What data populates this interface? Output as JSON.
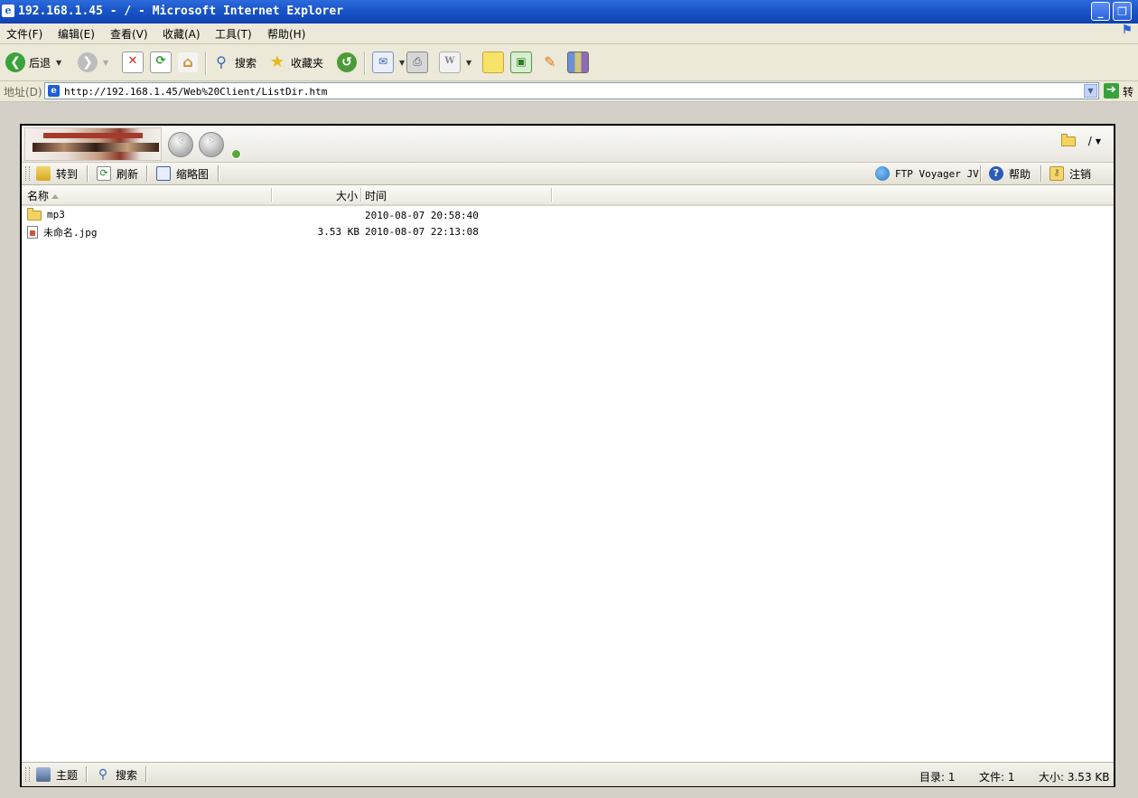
{
  "window": {
    "title": "192.168.1.45 - / - Microsoft Internet Explorer",
    "minimize_glyph": "_",
    "restore_glyph": "❐"
  },
  "menu": [
    "文件(F)",
    "编辑(E)",
    "查看(V)",
    "收藏(A)",
    "工具(T)",
    "帮助(H)"
  ],
  "toolbar": {
    "back_label": "后退",
    "search_label": "搜索",
    "favorites_label": "收藏夹"
  },
  "address": {
    "label": "地址(D)",
    "url": "http://192.168.1.45/Web%20Client/ListDir.htm",
    "go_label": "转"
  },
  "ftp": {
    "current_path": "/",
    "toolbar": {
      "goto_label": "转到",
      "refresh_label": "刷新",
      "thumbnail_label": "缩略图",
      "voyager_label": "FTP Voyager JV",
      "help_label": "帮助",
      "logout_label": "注销"
    },
    "columns": {
      "name": "名称",
      "size": "大小",
      "time": "时间"
    },
    "files": [
      {
        "name": "mp3",
        "size": "",
        "time": "2010-08-07 20:58:40",
        "type": "folder"
      },
      {
        "name": "未命名.jpg",
        "size": "3.53 KB",
        "time": "2010-08-07 22:13:08",
        "type": "image"
      }
    ],
    "statusbar": {
      "theme_label": "主题",
      "search_label": "搜索",
      "dirs": "目录: 1",
      "files": "文件: 1",
      "size": "大小: 3.53 KB"
    }
  },
  "colors": {
    "titlebar": "#1b56c9",
    "chrome": "#ece9d8",
    "folder": "#f4d35e"
  }
}
